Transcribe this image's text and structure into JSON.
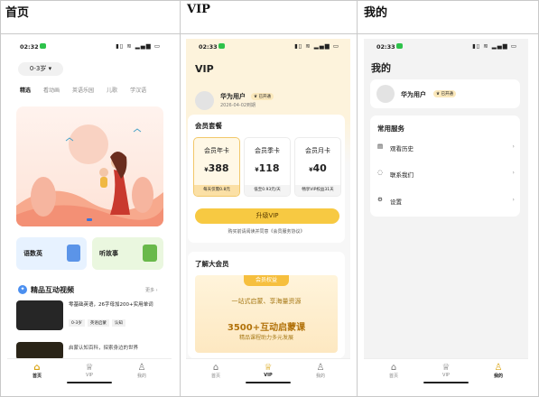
{
  "headers": {
    "home": "首页",
    "vip": "VIP",
    "mine": "我的"
  },
  "status": {
    "time": "02:32",
    "time2": "02:33",
    "right": "▮▯ ≋ ▂▄▆ ▭"
  },
  "home": {
    "age": "0-3岁 ▾",
    "categories": [
      "精选",
      "看动画",
      "英语乐园",
      "儿歌",
      "学汉语"
    ],
    "cards": [
      "语数英",
      "听故事"
    ],
    "section_title": "精品互动视频",
    "more": "更多 ›",
    "items": [
      {
        "title": "零基础英语，26字母加200+实用单词",
        "tags": [
          "0-3岁",
          "英语启蒙",
          "认知"
        ]
      },
      {
        "title": "启蒙认知百科，探索身边的世界"
      }
    ]
  },
  "vip": {
    "title": "VIP",
    "user": "华为用户",
    "badge": "♛ 已开通",
    "expire": "2026-04-02到期",
    "pkg_title": "会员套餐",
    "plans": [
      {
        "name": "会员年卡",
        "price": "388",
        "note": "每天仅需0.8元"
      },
      {
        "name": "会员季卡",
        "price": "118",
        "note": "低至0.93元/天"
      },
      {
        "name": "会员月卡",
        "price": "40",
        "note": "畅享VIP权益31天"
      }
    ],
    "cta": "升级VIP",
    "agree": "购买前请阅读并同意《会员服务协议》",
    "learn": "了解大会员",
    "benefit_tag": "会员权益",
    "benefit1": "一站式启蒙、享海量资源",
    "benefit2": "3500+互动启蒙课",
    "benefit3": "精品课程助力多元发展"
  },
  "mine": {
    "title": "我的",
    "user": "华为用户",
    "badge": "♛ 已开通",
    "svc_title": "常用服务",
    "services": [
      "观看历史",
      "联系我们",
      "设置"
    ]
  },
  "tabs": {
    "home": "首页",
    "vip": "VIP",
    "mine": "我的"
  },
  "colors": {
    "accent": "#f7c942",
    "text_gold": "#a77a18"
  }
}
